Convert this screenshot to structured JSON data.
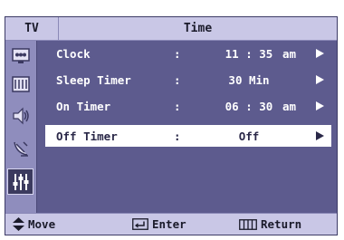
{
  "header": {
    "source_label": "TV",
    "menu_title": "Time"
  },
  "sidebar": {
    "icons": [
      "picture-icon",
      "sound-icon",
      "speaker-icon",
      "channel-icon",
      "setup-icon"
    ],
    "active": "setup-icon"
  },
  "rows": [
    {
      "label": "Clock",
      "colon": ":",
      "value": "11 : 35",
      "ampm": "am",
      "selected": false
    },
    {
      "label": "Sleep Timer",
      "colon": ":",
      "value": "30 Min",
      "ampm": "",
      "selected": false
    },
    {
      "label": "On Timer",
      "colon": ":",
      "value": "06 : 30",
      "ampm": "am",
      "selected": false
    },
    {
      "label": "Off Timer",
      "colon": ":",
      "value": "Off",
      "ampm": "",
      "selected": true
    }
  ],
  "footer": {
    "move_label": "Move",
    "enter_label": "Enter",
    "return_label": "Return"
  },
  "colors": {
    "panel": "#5d5b8e",
    "header": "#c9c7e6",
    "sidebar": "#8f8dbd",
    "highlight": "#ffffff"
  }
}
